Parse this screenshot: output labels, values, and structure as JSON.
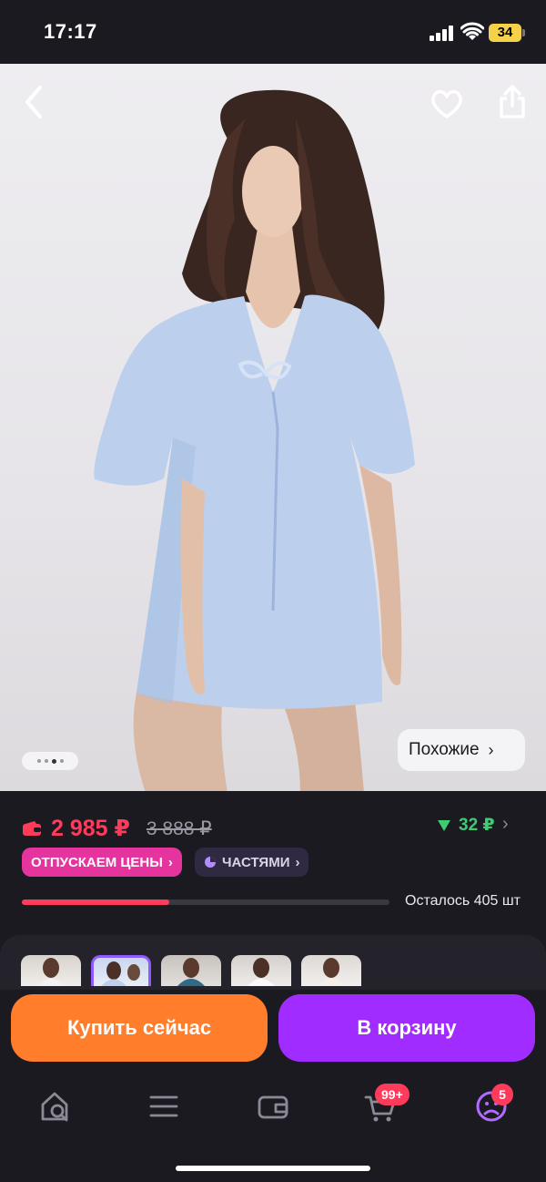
{
  "status_bar": {
    "time": "17:17",
    "battery": "34"
  },
  "hero": {
    "similar_label": "Похожие",
    "gallery_dots": 4,
    "active_dot": 2
  },
  "price": {
    "current": "2 985 ₽",
    "old": "3 888 ₽",
    "bonus": "32 ₽",
    "badges": {
      "promo": "ОТПУСКАЕМ ЦЕНЫ",
      "installments": "ЧАСТЯМИ"
    },
    "stock_text": "Осталось 405 шт",
    "stock_progress": 0.4
  },
  "actions": {
    "buy_now": "Купить сейчас",
    "add_to_cart": "В корзину"
  },
  "nav": {
    "items": [
      "home-search",
      "catalog",
      "wallet",
      "cart",
      "profile"
    ],
    "cart_badge": "99+",
    "profile_badge": "5"
  },
  "colors": {
    "accent_pink": "#e6349e",
    "accent_purple": "#a12cff",
    "accent_orange": "#ff7d2b",
    "price_red": "#ff3b5c",
    "bonus_green": "#3ecb73"
  }
}
